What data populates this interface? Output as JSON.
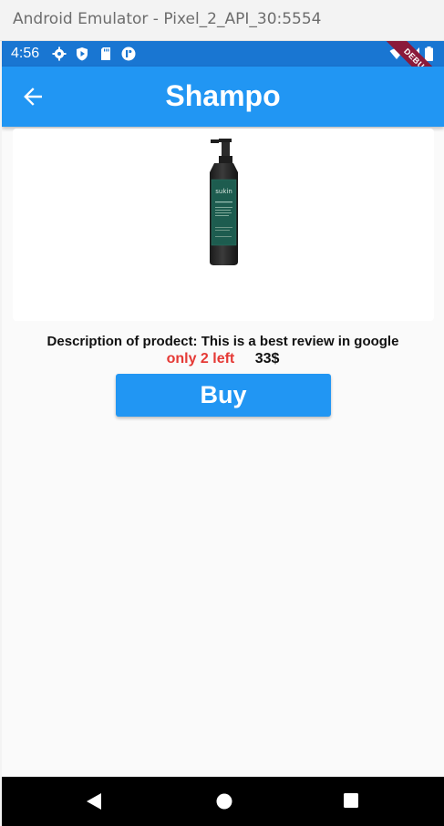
{
  "window": {
    "title": "Android Emulator - Pixel_2_API_30:5554"
  },
  "status_bar": {
    "time": "4:56",
    "icons": [
      "settings-icon",
      "play-protect-icon",
      "sd-card-icon",
      "notification-icon"
    ],
    "right_icons": [
      "wifi-icon",
      "signal-icon",
      "battery-icon"
    ],
    "debug_label": "DEBUG"
  },
  "app_bar": {
    "title": "Shampo",
    "back_icon": "arrow-left-icon"
  },
  "product": {
    "image": "shampoo-bottle-image",
    "bottle_brand": "sukin",
    "description": "Description of prodect: This is a best review in google",
    "stock": "only 2 left",
    "price": "33$",
    "buy_label": "Buy"
  },
  "nav_bar": {
    "buttons": [
      "back-triangle-icon",
      "home-circle-icon",
      "recents-square-icon"
    ]
  },
  "colors": {
    "primary": "#2196f3",
    "status_bar": "#1976d2",
    "stock_text": "#e53935",
    "debug_banner": "#8b1a3a"
  }
}
